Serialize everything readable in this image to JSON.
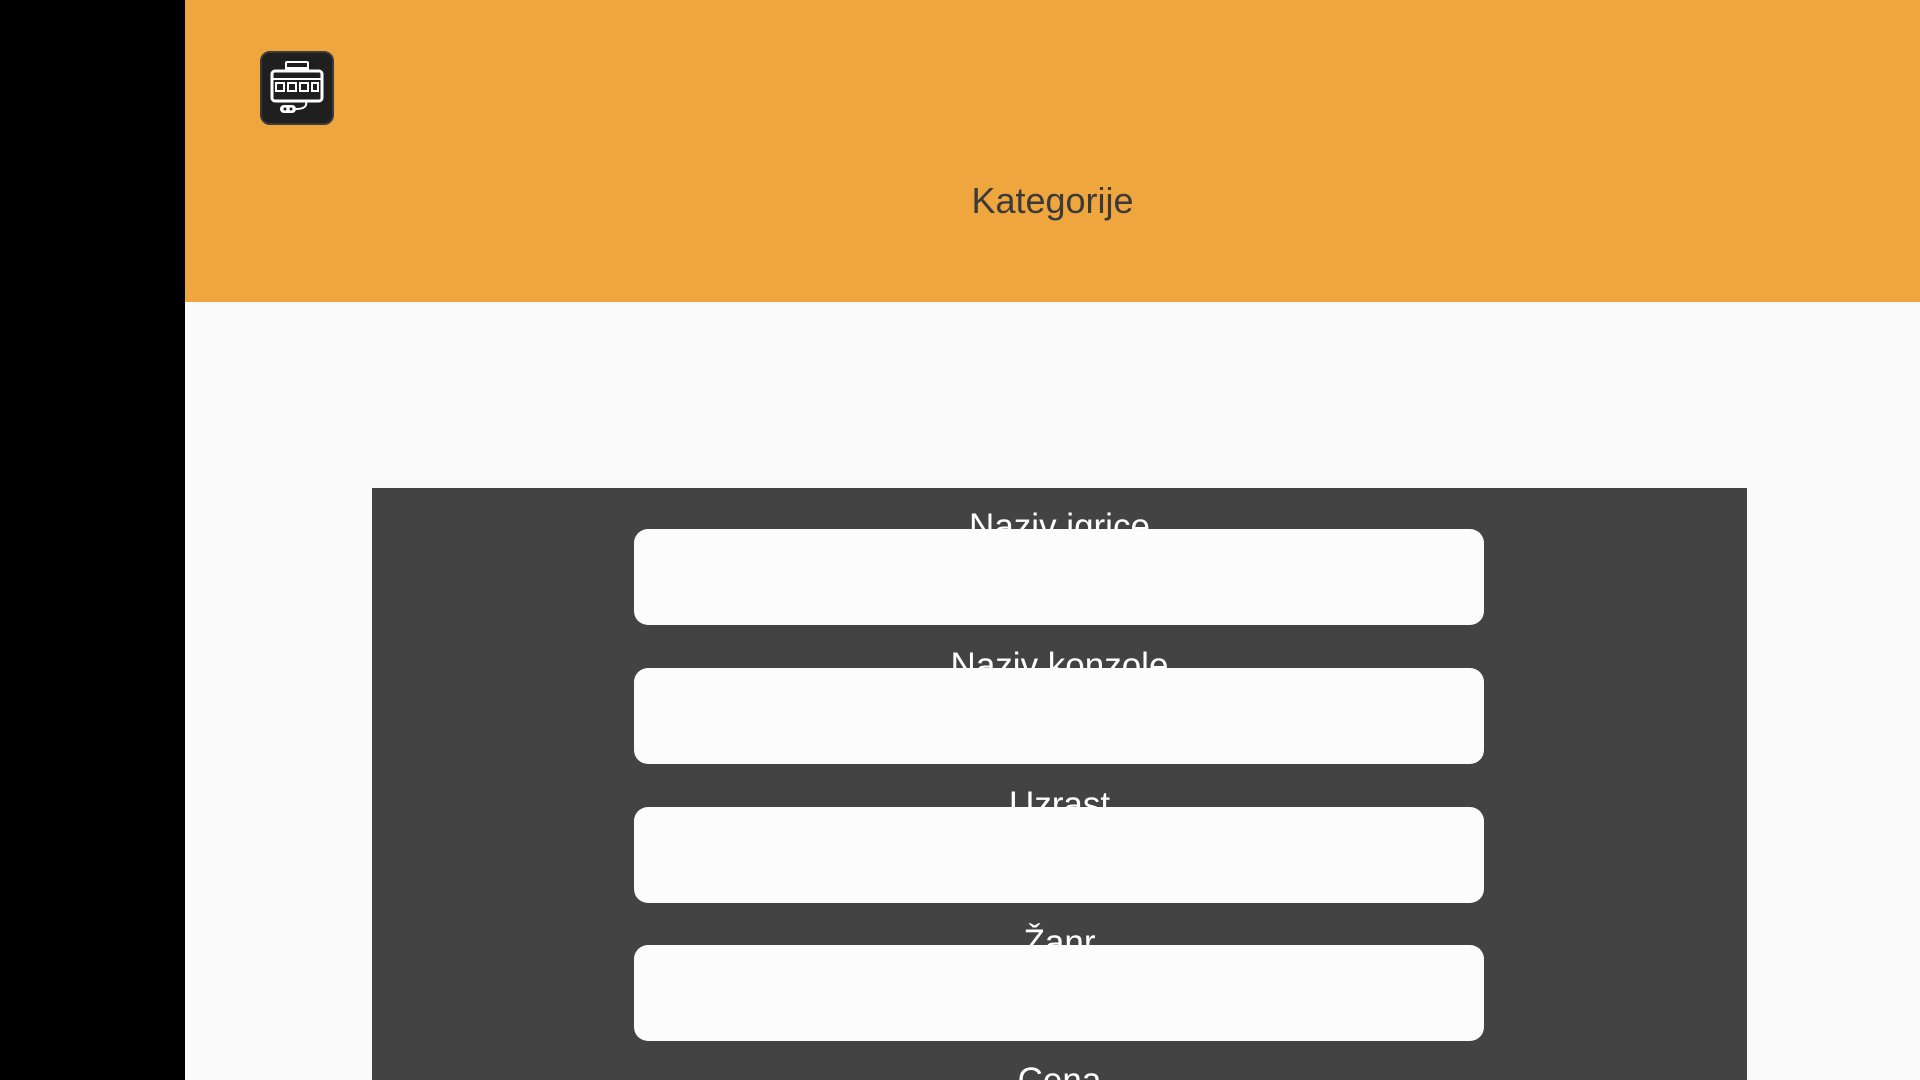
{
  "header": {
    "logo_icon": "retro-console-icon",
    "title": "Kategorije",
    "background": "#f0a63e"
  },
  "form": {
    "background": "#434343",
    "fields": [
      {
        "label": "Naziv igrice",
        "value": "",
        "placeholder": ""
      },
      {
        "label": "Naziv konzole",
        "value": "",
        "placeholder": ""
      },
      {
        "label": "Uzrast",
        "value": "",
        "placeholder": ""
      },
      {
        "label": "Žanr",
        "value": "",
        "placeholder": ""
      },
      {
        "label": "Cena",
        "value": "",
        "placeholder": ""
      }
    ]
  }
}
